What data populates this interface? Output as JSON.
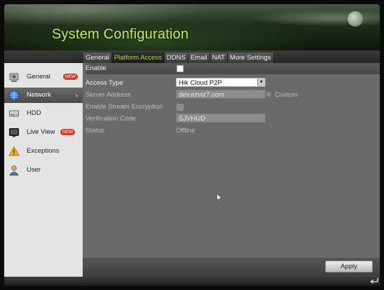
{
  "header": {
    "title": "System Configuration"
  },
  "tabs": [
    {
      "label": "General",
      "active": false
    },
    {
      "label": "Platform Access",
      "active": true
    },
    {
      "label": "DDNS",
      "active": false
    },
    {
      "label": "Email",
      "active": false
    },
    {
      "label": "NAT",
      "active": false
    },
    {
      "label": "More Settings",
      "active": false
    }
  ],
  "sidebar": {
    "items": [
      {
        "label": "General",
        "icon": "general-settings-icon",
        "badge": "NEW",
        "active": false
      },
      {
        "label": "Network",
        "icon": "network-globe-icon",
        "badge": "",
        "active": true
      },
      {
        "label": "HDD",
        "icon": "hdd-icon",
        "badge": "",
        "active": false
      },
      {
        "label": "Live View",
        "icon": "live-view-monitor-icon",
        "badge": "NEW",
        "active": false
      },
      {
        "label": "Exceptions",
        "icon": "warning-triangle-icon",
        "badge": "",
        "active": false
      },
      {
        "label": "User",
        "icon": "user-icon",
        "badge": "",
        "active": false
      }
    ]
  },
  "form": {
    "enable": {
      "label": "Enable",
      "checked": true
    },
    "access_type": {
      "label": "Access Type",
      "value": "Hik Cloud P2P"
    },
    "server_address": {
      "label": "Server Address",
      "value": "dev.ezviz7.com",
      "custom_label": "Custom"
    },
    "stream_encryption": {
      "label": "Enable Stream Encryption",
      "checked": false
    },
    "verification_code": {
      "label": "Verification Code",
      "value": "SJVHUD"
    },
    "status": {
      "label": "Status",
      "value": "Offline"
    }
  },
  "footer": {
    "apply_label": "Apply"
  },
  "colors": {
    "accent_green": "#a8dd4f",
    "title_green": "#c9ee5e",
    "badge_red": "#d63a2a"
  }
}
